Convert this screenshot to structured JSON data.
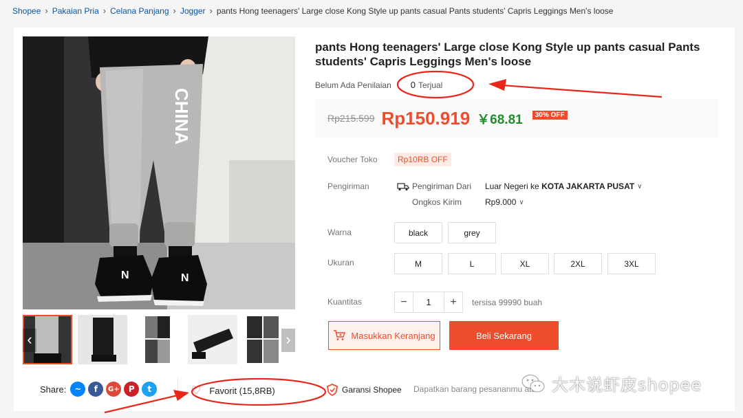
{
  "breadcrumb": {
    "items": [
      "Shopee",
      "Pakaian Pria",
      "Celana Panjang",
      "Jogger"
    ],
    "current": "pants Hong teenagers' Large close Kong Style up pants casual Pants students' Capris Leggings Men's loose"
  },
  "gallery": {
    "main_print_text": "CHINA",
    "prev_label": "‹",
    "next_label": "›"
  },
  "share": {
    "label": "Share:",
    "networks": [
      "messenger",
      "facebook",
      "google-plus",
      "pinterest",
      "twitter"
    ]
  },
  "favorite": {
    "label": "Favorit (15,8RB)"
  },
  "guarantee": {
    "label": "Garansi Shopee",
    "note": "Dapatkan barang pesananmu atau"
  },
  "product": {
    "title": "pants Hong teenagers' Large close Kong Style up pants casual Pants students' Capris Leggings Men's loose",
    "rating_text": "Belum Ada Penilaian",
    "sold_count": "0",
    "sold_label": "Terjual"
  },
  "price": {
    "original": "Rp215.599",
    "current": "Rp150.919",
    "cny": "￥68.81",
    "discount": "30% OFF"
  },
  "voucher": {
    "label": "Voucher Toko",
    "value": "Rp10RB OFF"
  },
  "shipping": {
    "label": "Pengiriman",
    "from_label": "Pengiriman Dari",
    "from_value": "Luar Negeri ke",
    "destination": "KOTA JAKARTA PUSAT",
    "cost_label": "Ongkos Kirim",
    "cost_value": "Rp9.000"
  },
  "variants": {
    "color_label": "Warna",
    "colors": [
      "black",
      "grey"
    ],
    "size_label": "Ukuran",
    "sizes": [
      "M",
      "L",
      "XL",
      "2XL",
      "3XL"
    ]
  },
  "quantity": {
    "label": "Kuantitas",
    "minus": "−",
    "value": "1",
    "plus": "+",
    "stock": "tersisa 99990 buah"
  },
  "actions": {
    "add_to_cart": "Masukkan Keranjang",
    "buy_now": "Beli Sekarang"
  },
  "colors": {
    "accent": "#ee4d2d",
    "annotation": "#e8261b",
    "cny_green": "#218c2a"
  },
  "watermark": {
    "text": "大木说虾皮shopee"
  }
}
